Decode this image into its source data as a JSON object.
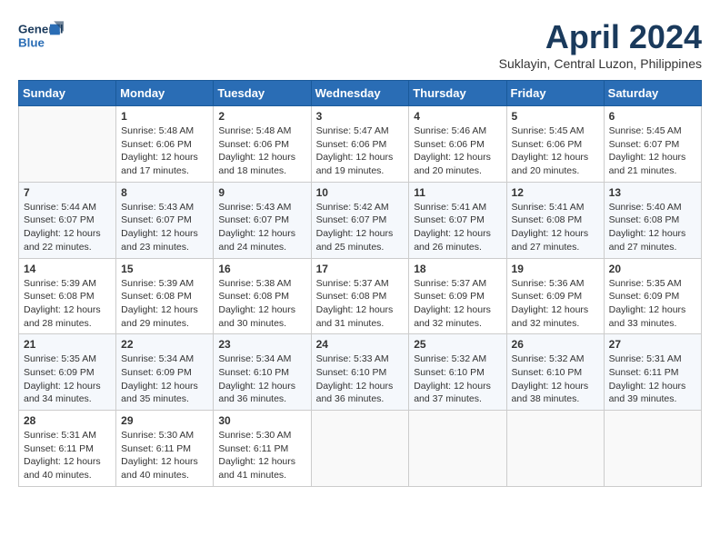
{
  "header": {
    "logo_line1": "General",
    "logo_line2": "Blue",
    "month_title": "April 2024",
    "location": "Suklayin, Central Luzon, Philippines"
  },
  "weekdays": [
    "Sunday",
    "Monday",
    "Tuesday",
    "Wednesday",
    "Thursday",
    "Friday",
    "Saturday"
  ],
  "weeks": [
    [
      {
        "day": "",
        "sunrise": "",
        "sunset": "",
        "daylight": ""
      },
      {
        "day": "1",
        "sunrise": "Sunrise: 5:48 AM",
        "sunset": "Sunset: 6:06 PM",
        "daylight": "Daylight: 12 hours and 17 minutes."
      },
      {
        "day": "2",
        "sunrise": "Sunrise: 5:48 AM",
        "sunset": "Sunset: 6:06 PM",
        "daylight": "Daylight: 12 hours and 18 minutes."
      },
      {
        "day": "3",
        "sunrise": "Sunrise: 5:47 AM",
        "sunset": "Sunset: 6:06 PM",
        "daylight": "Daylight: 12 hours and 19 minutes."
      },
      {
        "day": "4",
        "sunrise": "Sunrise: 5:46 AM",
        "sunset": "Sunset: 6:06 PM",
        "daylight": "Daylight: 12 hours and 20 minutes."
      },
      {
        "day": "5",
        "sunrise": "Sunrise: 5:45 AM",
        "sunset": "Sunset: 6:06 PM",
        "daylight": "Daylight: 12 hours and 20 minutes."
      },
      {
        "day": "6",
        "sunrise": "Sunrise: 5:45 AM",
        "sunset": "Sunset: 6:07 PM",
        "daylight": "Daylight: 12 hours and 21 minutes."
      }
    ],
    [
      {
        "day": "7",
        "sunrise": "Sunrise: 5:44 AM",
        "sunset": "Sunset: 6:07 PM",
        "daylight": "Daylight: 12 hours and 22 minutes."
      },
      {
        "day": "8",
        "sunrise": "Sunrise: 5:43 AM",
        "sunset": "Sunset: 6:07 PM",
        "daylight": "Daylight: 12 hours and 23 minutes."
      },
      {
        "day": "9",
        "sunrise": "Sunrise: 5:43 AM",
        "sunset": "Sunset: 6:07 PM",
        "daylight": "Daylight: 12 hours and 24 minutes."
      },
      {
        "day": "10",
        "sunrise": "Sunrise: 5:42 AM",
        "sunset": "Sunset: 6:07 PM",
        "daylight": "Daylight: 12 hours and 25 minutes."
      },
      {
        "day": "11",
        "sunrise": "Sunrise: 5:41 AM",
        "sunset": "Sunset: 6:07 PM",
        "daylight": "Daylight: 12 hours and 26 minutes."
      },
      {
        "day": "12",
        "sunrise": "Sunrise: 5:41 AM",
        "sunset": "Sunset: 6:08 PM",
        "daylight": "Daylight: 12 hours and 27 minutes."
      },
      {
        "day": "13",
        "sunrise": "Sunrise: 5:40 AM",
        "sunset": "Sunset: 6:08 PM",
        "daylight": "Daylight: 12 hours and 27 minutes."
      }
    ],
    [
      {
        "day": "14",
        "sunrise": "Sunrise: 5:39 AM",
        "sunset": "Sunset: 6:08 PM",
        "daylight": "Daylight: 12 hours and 28 minutes."
      },
      {
        "day": "15",
        "sunrise": "Sunrise: 5:39 AM",
        "sunset": "Sunset: 6:08 PM",
        "daylight": "Daylight: 12 hours and 29 minutes."
      },
      {
        "day": "16",
        "sunrise": "Sunrise: 5:38 AM",
        "sunset": "Sunset: 6:08 PM",
        "daylight": "Daylight: 12 hours and 30 minutes."
      },
      {
        "day": "17",
        "sunrise": "Sunrise: 5:37 AM",
        "sunset": "Sunset: 6:08 PM",
        "daylight": "Daylight: 12 hours and 31 minutes."
      },
      {
        "day": "18",
        "sunrise": "Sunrise: 5:37 AM",
        "sunset": "Sunset: 6:09 PM",
        "daylight": "Daylight: 12 hours and 32 minutes."
      },
      {
        "day": "19",
        "sunrise": "Sunrise: 5:36 AM",
        "sunset": "Sunset: 6:09 PM",
        "daylight": "Daylight: 12 hours and 32 minutes."
      },
      {
        "day": "20",
        "sunrise": "Sunrise: 5:35 AM",
        "sunset": "Sunset: 6:09 PM",
        "daylight": "Daylight: 12 hours and 33 minutes."
      }
    ],
    [
      {
        "day": "21",
        "sunrise": "Sunrise: 5:35 AM",
        "sunset": "Sunset: 6:09 PM",
        "daylight": "Daylight: 12 hours and 34 minutes."
      },
      {
        "day": "22",
        "sunrise": "Sunrise: 5:34 AM",
        "sunset": "Sunset: 6:09 PM",
        "daylight": "Daylight: 12 hours and 35 minutes."
      },
      {
        "day": "23",
        "sunrise": "Sunrise: 5:34 AM",
        "sunset": "Sunset: 6:10 PM",
        "daylight": "Daylight: 12 hours and 36 minutes."
      },
      {
        "day": "24",
        "sunrise": "Sunrise: 5:33 AM",
        "sunset": "Sunset: 6:10 PM",
        "daylight": "Daylight: 12 hours and 36 minutes."
      },
      {
        "day": "25",
        "sunrise": "Sunrise: 5:32 AM",
        "sunset": "Sunset: 6:10 PM",
        "daylight": "Daylight: 12 hours and 37 minutes."
      },
      {
        "day": "26",
        "sunrise": "Sunrise: 5:32 AM",
        "sunset": "Sunset: 6:10 PM",
        "daylight": "Daylight: 12 hours and 38 minutes."
      },
      {
        "day": "27",
        "sunrise": "Sunrise: 5:31 AM",
        "sunset": "Sunset: 6:11 PM",
        "daylight": "Daylight: 12 hours and 39 minutes."
      }
    ],
    [
      {
        "day": "28",
        "sunrise": "Sunrise: 5:31 AM",
        "sunset": "Sunset: 6:11 PM",
        "daylight": "Daylight: 12 hours and 40 minutes."
      },
      {
        "day": "29",
        "sunrise": "Sunrise: 5:30 AM",
        "sunset": "Sunset: 6:11 PM",
        "daylight": "Daylight: 12 hours and 40 minutes."
      },
      {
        "day": "30",
        "sunrise": "Sunrise: 5:30 AM",
        "sunset": "Sunset: 6:11 PM",
        "daylight": "Daylight: 12 hours and 41 minutes."
      },
      {
        "day": "",
        "sunrise": "",
        "sunset": "",
        "daylight": ""
      },
      {
        "day": "",
        "sunrise": "",
        "sunset": "",
        "daylight": ""
      },
      {
        "day": "",
        "sunrise": "",
        "sunset": "",
        "daylight": ""
      },
      {
        "day": "",
        "sunrise": "",
        "sunset": "",
        "daylight": ""
      }
    ]
  ]
}
